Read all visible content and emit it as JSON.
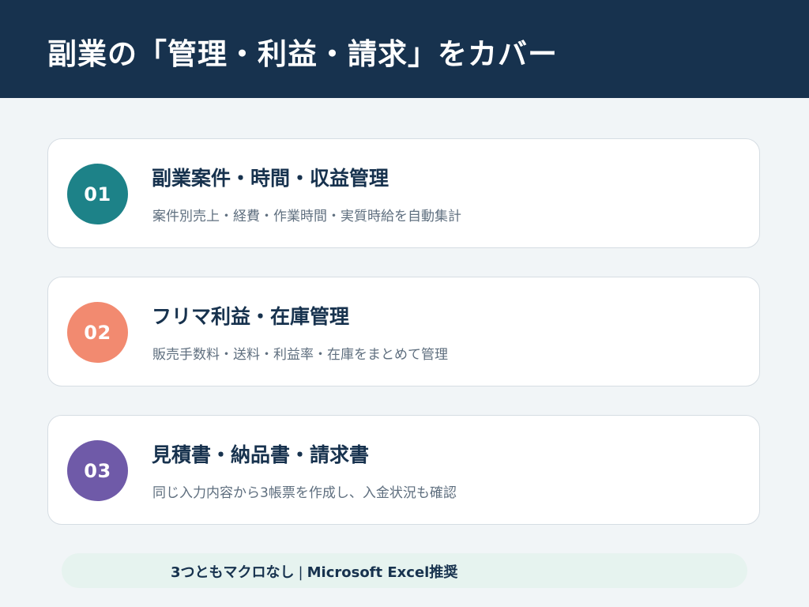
{
  "header": {
    "title": "副業の「管理・利益・請求」をカバー"
  },
  "colors": {
    "header_bg": "#17324e",
    "badge_1": "#1d8288",
    "badge_2": "#f28a70",
    "badge_3": "#6f5aa8",
    "footer_bg": "#e6f3ef"
  },
  "cards": [
    {
      "number": "01",
      "title": "副業案件・時間・収益管理",
      "description": "案件別売上・経費・作業時間・実質時給を自動集計"
    },
    {
      "number": "02",
      "title": "フリマ利益・在庫管理",
      "description": "販売手数料・送料・利益率・在庫をまとめて管理"
    },
    {
      "number": "03",
      "title": "見積書・納品書・請求書",
      "description": "同じ入力内容から3帳票を作成し、入金状況も確認"
    }
  ],
  "footer": {
    "left_text": "3つともマクロなし",
    "separator": "|",
    "right_text": "Microsoft Excel推奨"
  }
}
